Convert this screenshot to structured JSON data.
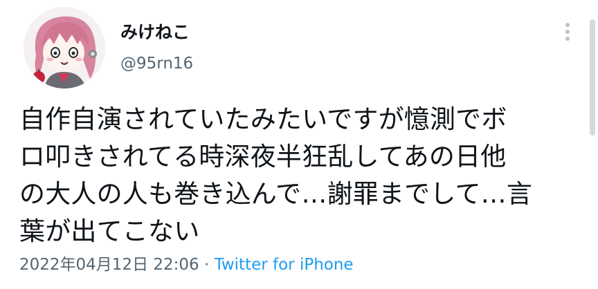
{
  "author": {
    "display_name": "みけねこ",
    "handle": "@95rn16",
    "avatar_icon": "anime-girl-avatar-icon"
  },
  "menu": {
    "icon": "more-vertical-icon"
  },
  "tweet": {
    "lines": [
      "自作自演されていたみたいですが憶測でボ",
      "ロ叩きされてる時深夜半狂乱してあの日他",
      "の大人の人も巻き込んで…謝罪までして…言",
      "葉が出てこない"
    ],
    "timestamp": "2022年04月12日 22:06",
    "separator": " · ",
    "source": "Twitter for iPhone"
  },
  "colors": {
    "text": "#0f1419",
    "secondary": "#536471",
    "link": "#1d9bf0"
  }
}
